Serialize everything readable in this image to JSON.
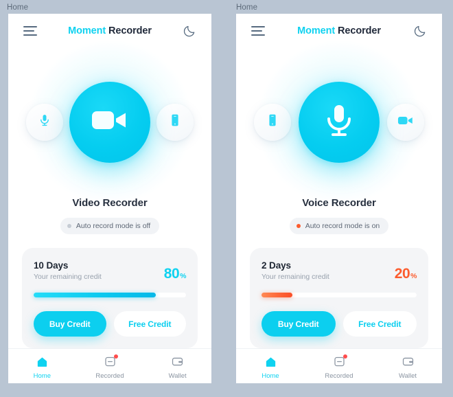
{
  "background_color": "#b9c5d3",
  "accent_cyan": "#0fd2f0",
  "accent_orange": "#fc5c2e",
  "breadcrumbs": {
    "left": "Home",
    "right": "Home"
  },
  "panels": [
    {
      "id": "video",
      "appbar": {
        "menu_icon": "hamburger-menu-icon",
        "brand_first": "Moment",
        "brand_second": "Recorder",
        "theme_icon": "moon-icon"
      },
      "hero": {
        "left_icon": "microphone-icon",
        "main_icon": "video-camera-icon",
        "right_icon": "phone-icon"
      },
      "title": "Video Recorder",
      "status": {
        "text": "Auto record mode is off",
        "dot_color": "#c6ccd4",
        "state": "off"
      },
      "credit": {
        "days": "10 Days",
        "subtitle": "Your remaining credit",
        "percent": "80",
        "percent_unit": "%",
        "percent_color": "#0fd2f0",
        "progress": 80,
        "buy_label": "Buy Credit",
        "free_label": "Free Credit"
      },
      "tabs": [
        {
          "label": "Home",
          "icon": "home-icon",
          "active": true,
          "badge": false
        },
        {
          "label": "Recorded",
          "icon": "recorded-icon",
          "active": false,
          "badge": true
        },
        {
          "label": "Wallet",
          "icon": "wallet-icon",
          "active": false,
          "badge": false
        }
      ]
    },
    {
      "id": "voice",
      "appbar": {
        "menu_icon": "hamburger-menu-icon",
        "brand_first": "Moment",
        "brand_second": "Recorder",
        "theme_icon": "moon-icon"
      },
      "hero": {
        "left_icon": "phone-icon",
        "main_icon": "microphone-icon",
        "right_icon": "video-camera-icon"
      },
      "title": "Voice Recorder",
      "status": {
        "text": "Auto record mode is on",
        "dot_color": "#fc5c2e",
        "state": "on"
      },
      "credit": {
        "days": "2 Days",
        "subtitle": "Your remaining credit",
        "percent": "20",
        "percent_unit": "%",
        "percent_color": "#fc5c2e",
        "progress": 20,
        "buy_label": "Buy Credit",
        "free_label": "Free Credit"
      },
      "tabs": [
        {
          "label": "Home",
          "icon": "home-icon",
          "active": true,
          "badge": false
        },
        {
          "label": "Recorded",
          "icon": "recorded-icon",
          "active": false,
          "badge": true
        },
        {
          "label": "Wallet",
          "icon": "wallet-icon",
          "active": false,
          "badge": false
        }
      ]
    }
  ]
}
